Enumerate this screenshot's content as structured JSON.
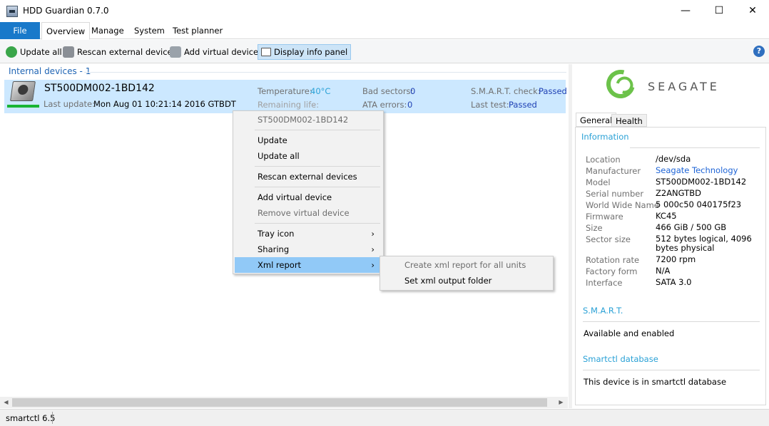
{
  "window": {
    "title": "HDD Guardian 0.7.0",
    "minimize": "—",
    "maximize": "☐",
    "close": "✕"
  },
  "menu": {
    "file": "File",
    "tabs": [
      "Overview",
      "Manage",
      "System",
      "Test planner"
    ]
  },
  "toolbar": {
    "update_all": "Update all",
    "rescan": "Rescan external devices",
    "add_virtual": "Add virtual device",
    "display_info": "Display info panel",
    "help": "?"
  },
  "devices": {
    "group_header": "Internal devices - 1",
    "device": {
      "name": "ST500DM002-1BD142",
      "last_update_label": "Last update:",
      "last_update": "Mon Aug 01 10:21:14 2016 GTBDT",
      "temperature_label": "Temperature:",
      "temperature": "40°C",
      "remaining_label": "Remaining life:",
      "remaining": "-",
      "bad_sectors_label": "Bad sectors:",
      "bad_sectors": "0",
      "ata_errors_label": "ATA errors:",
      "ata_errors": "0",
      "smart_check_label": "S.M.A.R.T. check:",
      "smart_check": "Passed",
      "last_test_label": "Last test:",
      "last_test": "Passed",
      "health_color": "#19b534"
    }
  },
  "context_menu": {
    "header": "ST500DM002-1BD142",
    "update": "Update",
    "update_all": "Update all",
    "rescan": "Rescan external devices",
    "add_virtual": "Add virtual device",
    "remove_virtual": "Remove virtual device",
    "tray_icon": "Tray icon",
    "sharing": "Sharing",
    "xml_report": "Xml report",
    "arrow": "›"
  },
  "sub_menu": {
    "create_report": "Create xml report for all units",
    "set_folder": "Set xml output folder"
  },
  "info_panel": {
    "brand": "SEAGATE",
    "tabs": [
      "General",
      "Health"
    ],
    "information_title": "Information",
    "rows": [
      {
        "label": "Location",
        "value": "/dev/sda"
      },
      {
        "label": "Manufacturer",
        "value": "Seagate Technology"
      },
      {
        "label": "Model",
        "value": "ST500DM002-1BD142"
      },
      {
        "label": "Serial number",
        "value": "Z2ANGTBD"
      },
      {
        "label": "World Wide Name",
        "value": "5 000c50 040175f23"
      },
      {
        "label": "Firmware",
        "value": "KC45"
      },
      {
        "label": "Size",
        "value": "466 GiB / 500 GB"
      },
      {
        "label": "Sector size",
        "value": "512 bytes logical, 4096 bytes physical"
      },
      {
        "label": "Rotation rate",
        "value": "7200 rpm"
      },
      {
        "label": "Factory form",
        "value": "N/A"
      },
      {
        "label": "Interface",
        "value": "SATA 3.0"
      }
    ],
    "smart_title": "S.M.A.R.T.",
    "smart_value": "Available and enabled",
    "db_title": "Smartctl database",
    "db_value": "This device is in smartctl database"
  },
  "status": {
    "text": "smartctl 6.5"
  },
  "colors": {
    "accent": "#1979ca",
    "selection": "#cce8ff",
    "link": "#1e64d6",
    "section": "#2aa1d6"
  }
}
